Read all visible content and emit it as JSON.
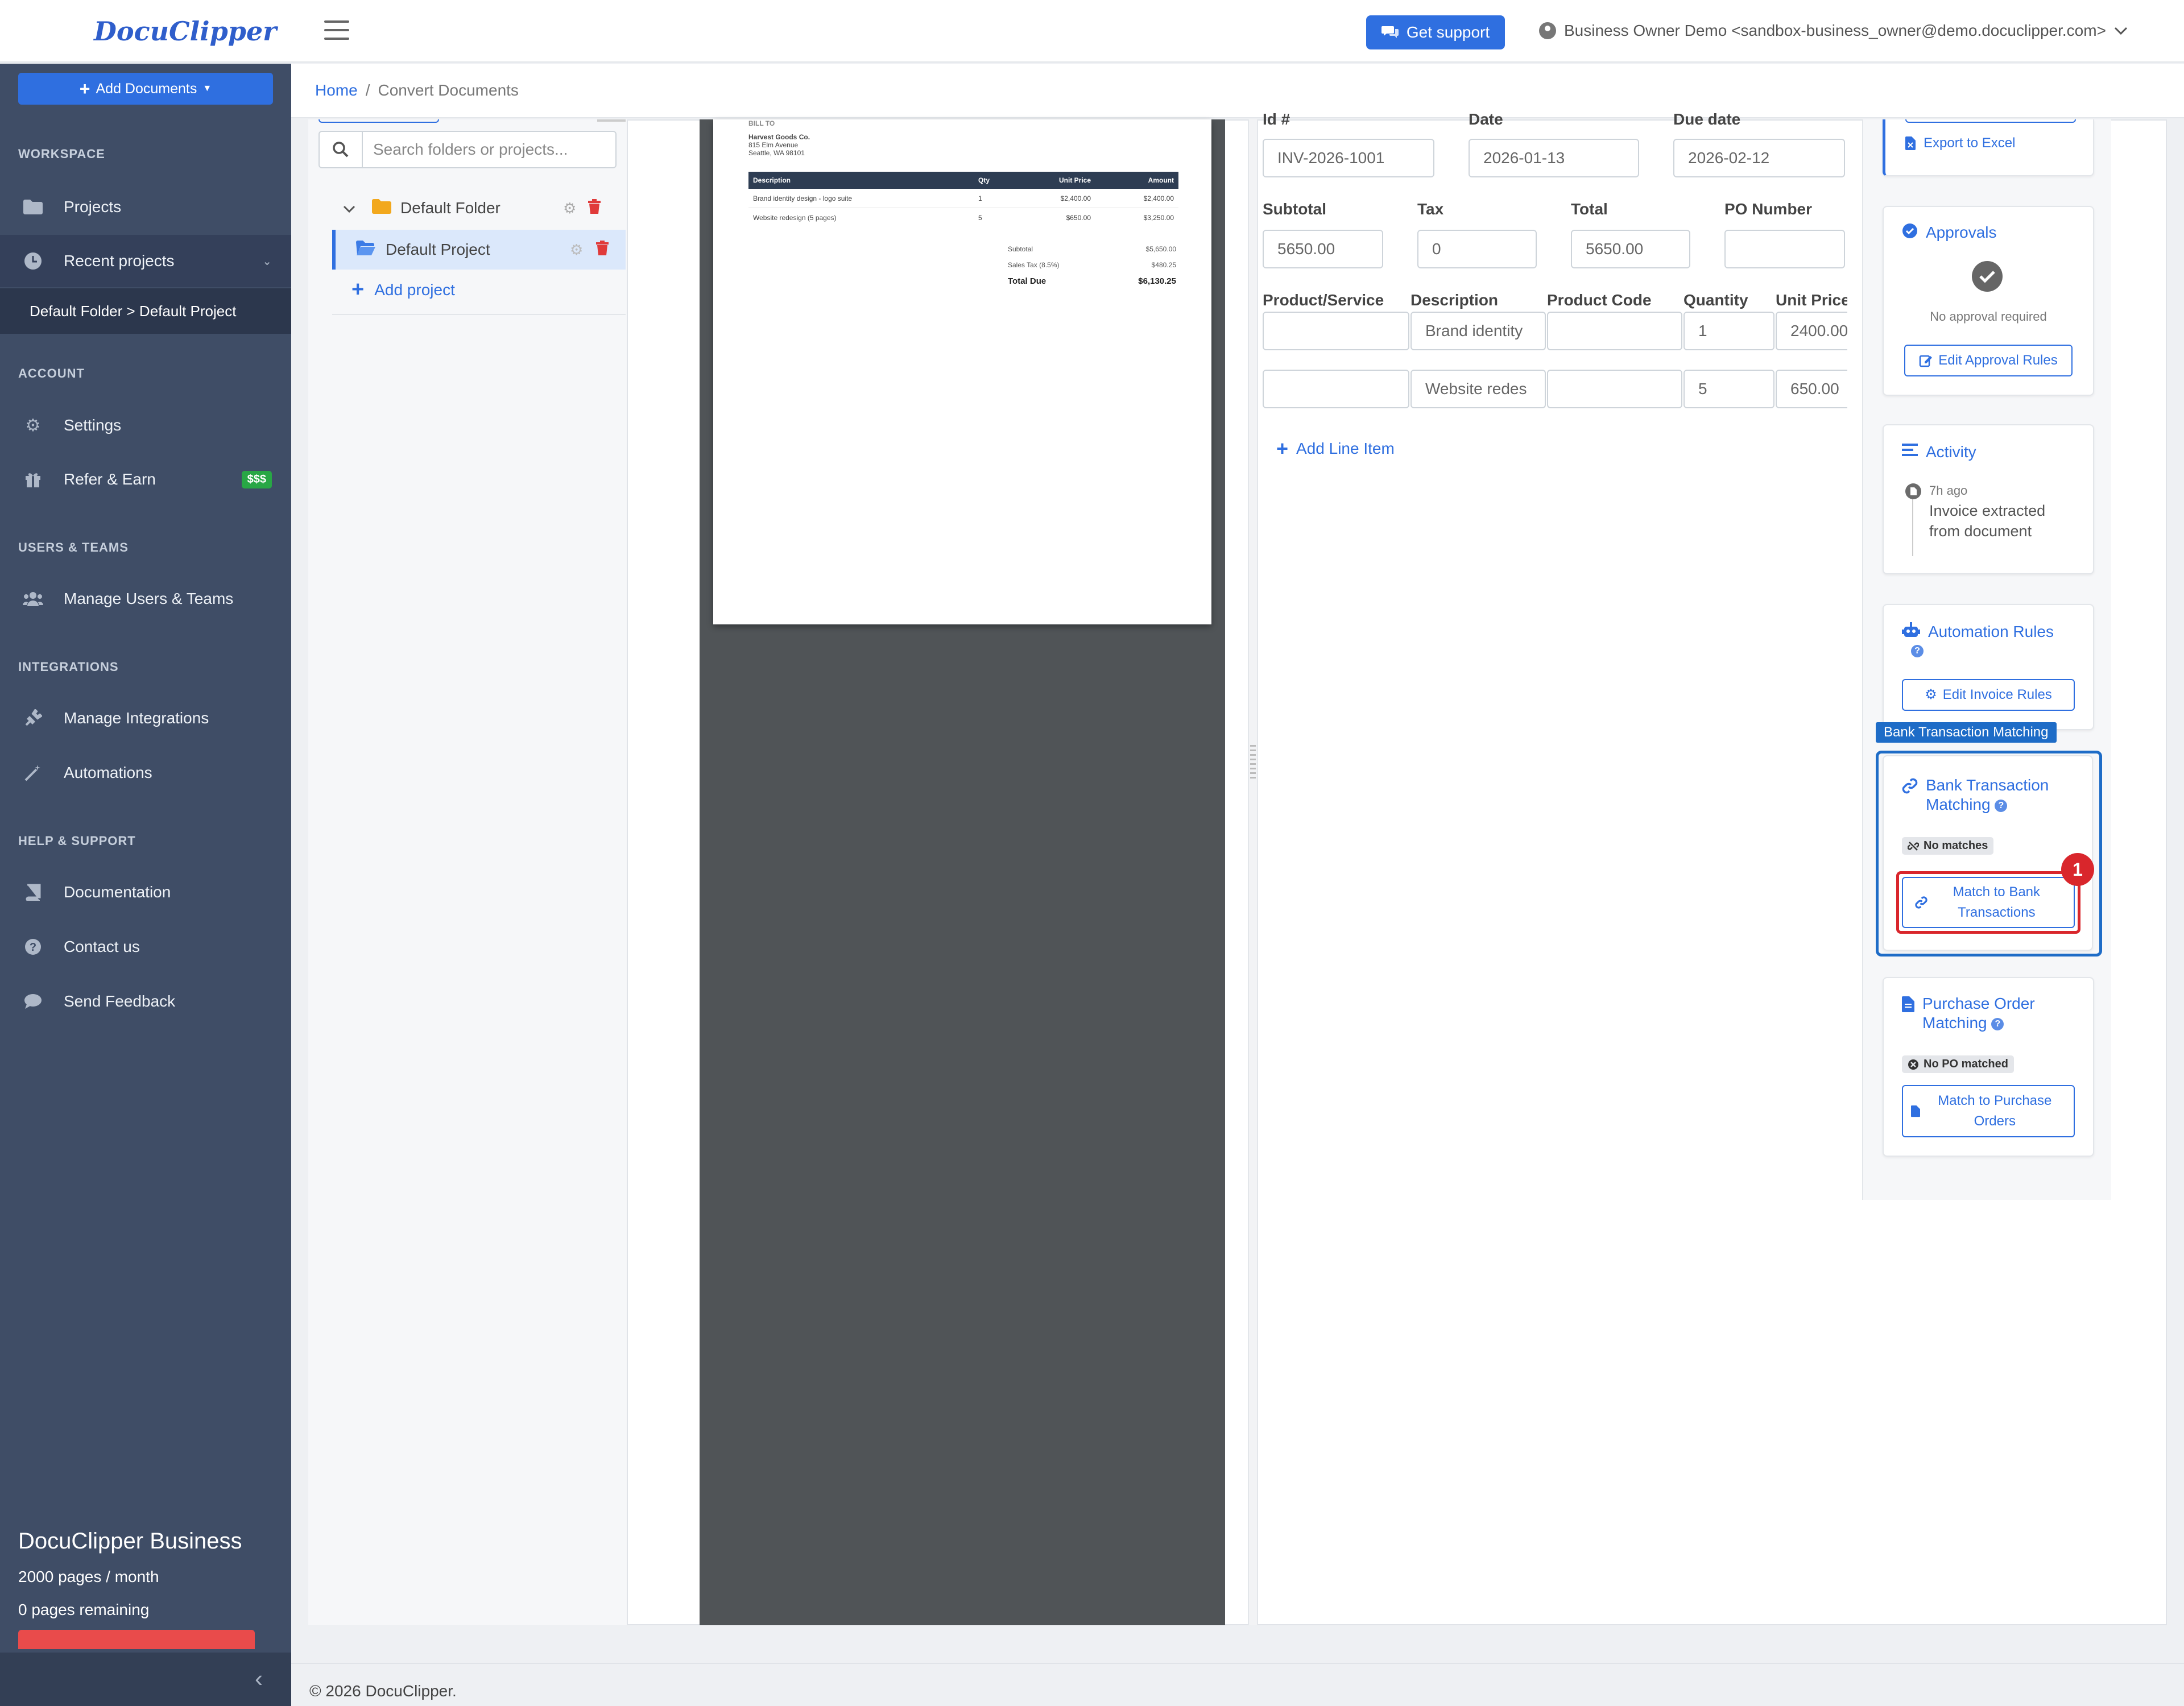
{
  "brand": {
    "logo": "DocuClipper"
  },
  "topbar": {
    "support_label": "Get support",
    "user_label": "Business Owner Demo <sandbox-business_owner@demo.docuclipper.com>"
  },
  "sidebar": {
    "add_documents_label": "Add Documents",
    "sections": {
      "workspace": "WORKSPACE",
      "account": "ACCOUNT",
      "users_teams": "USERS & TEAMS",
      "integrations": "INTEGRATIONS",
      "help": "HELP & SUPPORT"
    },
    "items": {
      "projects": "Projects",
      "recent": "Recent projects",
      "recent_sub": "Default Folder > Default Project",
      "settings": "Settings",
      "refer": "Refer & Earn",
      "refer_badge": "$$$",
      "manage_users": "Manage Users & Teams",
      "manage_integrations": "Manage Integrations",
      "automations": "Automations",
      "documentation": "Documentation",
      "contact": "Contact us",
      "feedback": "Send Feedback"
    },
    "plan": {
      "name": "DocuClipper Business",
      "pages": "2000 pages / month",
      "remaining": "0 pages remaining",
      "used_fraction": 1.0
    }
  },
  "breadcrumb": {
    "home": "Home",
    "separator": "/",
    "current": "Convert Documents"
  },
  "folders": {
    "search_placeholder": "Search folders or projects...",
    "folder_name": "Default Folder",
    "project_name": "Default Project",
    "add_project": "Add project"
  },
  "document_preview": {
    "bill_to_label": "BILL TO",
    "bill_to_lines": [
      "Harvest Goods Co.",
      "815 Elm Avenue",
      "Seattle, WA 98101"
    ],
    "columns": [
      "Description",
      "Qty",
      "Unit Price",
      "Amount"
    ],
    "rows": [
      [
        "Brand identity design - logo suite",
        "1",
        "$2,400.00",
        "$2,400.00"
      ],
      [
        "Website redesign (5 pages)",
        "5",
        "$650.00",
        "$3,250.00"
      ]
    ],
    "totals": [
      [
        "Subtotal",
        "$5,650.00"
      ],
      [
        "Sales Tax (8.5%)",
        "$480.25"
      ],
      [
        "Total Due",
        "$6,130.25"
      ]
    ]
  },
  "form": {
    "labels": {
      "id": "Id #",
      "date": "Date",
      "due_date": "Due date",
      "subtotal": "Subtotal",
      "tax": "Tax",
      "total": "Total",
      "po_number": "PO Number",
      "product": "Product/Service",
      "description": "Description",
      "product_code": "Product Code",
      "quantity": "Quantity",
      "unit_price": "Unit Price"
    },
    "values": {
      "id": "INV-2026-1001",
      "date": "2026-01-13",
      "due_date": "2026-02-12",
      "subtotal": "5650.00",
      "tax": "0",
      "total": "5650.00",
      "po_number": ""
    },
    "line_items": [
      {
        "product": "",
        "description": "Brand identity",
        "code": "",
        "quantity": "1",
        "unit_price": "2400.00"
      },
      {
        "product": "",
        "description": "Website redes",
        "code": "",
        "quantity": "5",
        "unit_price": "650.00"
      }
    ],
    "add_line_label": "Add Line Item"
  },
  "widgets": {
    "export_excel": "Export to Excel",
    "approvals": {
      "title": "Approvals",
      "status": "No approval required",
      "button": "Edit Approval Rules"
    },
    "activity": {
      "title": "Activity",
      "time": "7h ago",
      "event": "Invoice extracted from document"
    },
    "automation": {
      "title": "Automation Rules",
      "button": "Edit Invoice Rules"
    },
    "bank": {
      "tag": "Bank Transaction Matching",
      "title": "Bank Transaction Matching",
      "status": "No matches",
      "button": "Match to Bank Transactions"
    },
    "po": {
      "title": "Purchase Order Matching",
      "status": "No PO matched",
      "button": "Match to Purchase Orders"
    }
  },
  "annotation": {
    "marker": "1"
  },
  "footer": {
    "text": "© 2026 DocuClipper."
  },
  "colors": {
    "accent": "#2f6fe0",
    "sidebar": "#3f4d66",
    "highlight": "#1e6cc7",
    "marker": "#d9262c"
  }
}
